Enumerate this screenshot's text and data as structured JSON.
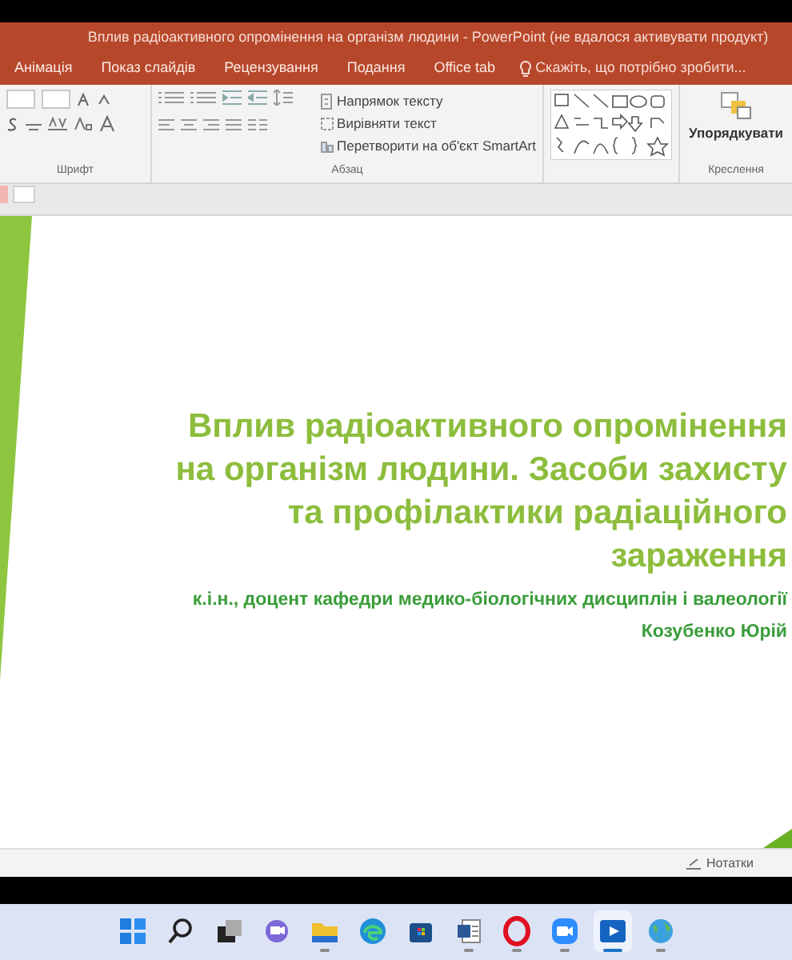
{
  "window": {
    "title": "Вплив радіоактивного опромінення на організм людини - PowerPoint (не вдалося активувати продукт)"
  },
  "tabs": [
    {
      "label": "Анімація",
      "selected": false
    },
    {
      "label": "Показ слайдів",
      "selected": false
    },
    {
      "label": "Рецензування",
      "selected": false
    },
    {
      "label": "Подання",
      "selected": false
    },
    {
      "label": "Office tab",
      "selected": false
    }
  ],
  "tell_me": {
    "placeholder": "Скажіть, що потрібно зробити..."
  },
  "ribbon": {
    "paragraph_commands": [
      {
        "label": "Напрямок тексту"
      },
      {
        "label": "Вирівняти текст"
      },
      {
        "label": "Перетворити на об'єкт SmartArt"
      }
    ],
    "arrange_label": "Упорядкувати",
    "groups": [
      {
        "label": "Шрифт"
      },
      {
        "label": "Абзац"
      },
      {
        "label": "Креслення"
      }
    ]
  },
  "slide": {
    "title_lines": [
      "Вплив радіоактивного опромінення",
      "на організм людини. Засоби захисту",
      "та профілактики радіаційного",
      "зараження"
    ],
    "subtitle_lines": [
      "к.і.н., доцент кафедри медико-біологічних дисциплін і валеології",
      "Козубенко Юрій"
    ]
  },
  "status_bar": {
    "notes": "Нотатки"
  },
  "taskbar": [
    {
      "kind": "start",
      "selected": false,
      "running": false
    },
    {
      "kind": "search",
      "selected": false,
      "running": false
    },
    {
      "kind": "taskview",
      "selected": false,
      "running": false
    },
    {
      "kind": "chat",
      "selected": false,
      "running": false
    },
    {
      "kind": "folder",
      "selected": false,
      "running": true
    },
    {
      "kind": "browser",
      "selected": false,
      "running": false
    },
    {
      "kind": "store",
      "selected": false,
      "running": false
    },
    {
      "kind": "word",
      "selected": false,
      "running": true
    },
    {
      "kind": "opera",
      "selected": false,
      "running": true
    },
    {
      "kind": "video",
      "selected": false,
      "running": true
    },
    {
      "kind": "player",
      "selected": true,
      "running": true
    },
    {
      "kind": "globe",
      "selected": false,
      "running": true
    }
  ]
}
